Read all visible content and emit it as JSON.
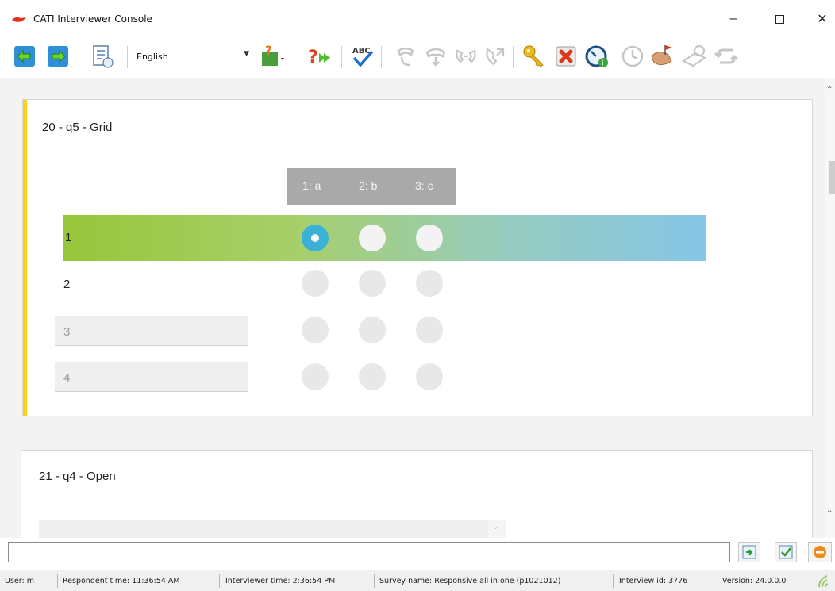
{
  "window": {
    "title": "CATI Interviewer Console"
  },
  "toolbar": {
    "language": "English",
    "icons": [
      "back-arrow-icon",
      "forward-arrow-icon",
      "document-clock-icon",
      "language-dropdown",
      "person-help-icon",
      "question-forward-icon",
      "spellcheck-icon",
      "phone-hangup-icon",
      "phone-down-icon",
      "phone-transfer-icon",
      "phone-callback-icon",
      "key-icon",
      "cancel-x-icon",
      "speedometer-icon",
      "timer-icon",
      "appointment-icon",
      "callback-clock-icon",
      "refresh-icon"
    ]
  },
  "questions": [
    {
      "title": "20 - q5 - Grid",
      "columns": [
        "1: a",
        "2: b",
        "3: c"
      ],
      "rows": [
        {
          "label": "1",
          "selected_column": 0
        },
        {
          "label": "2"
        },
        {
          "label": "3"
        },
        {
          "label": "4"
        }
      ]
    },
    {
      "title": "21 - q4 - Open"
    }
  ],
  "status": {
    "user_label": "User:",
    "user": "m",
    "respondent_time_label": "Respondent time:",
    "respondent_time": "11:36:54 AM",
    "interviewer_time_label": "Interviewer time:",
    "interviewer_time": "2:36:54 PM",
    "survey_name_label": "Survey name:",
    "survey_name": "Responsive all in one (p1021012)",
    "interview_id_label": "Interview id:",
    "interview_id": "3776",
    "version_label": "Version:",
    "version": "24.0.0.0"
  }
}
